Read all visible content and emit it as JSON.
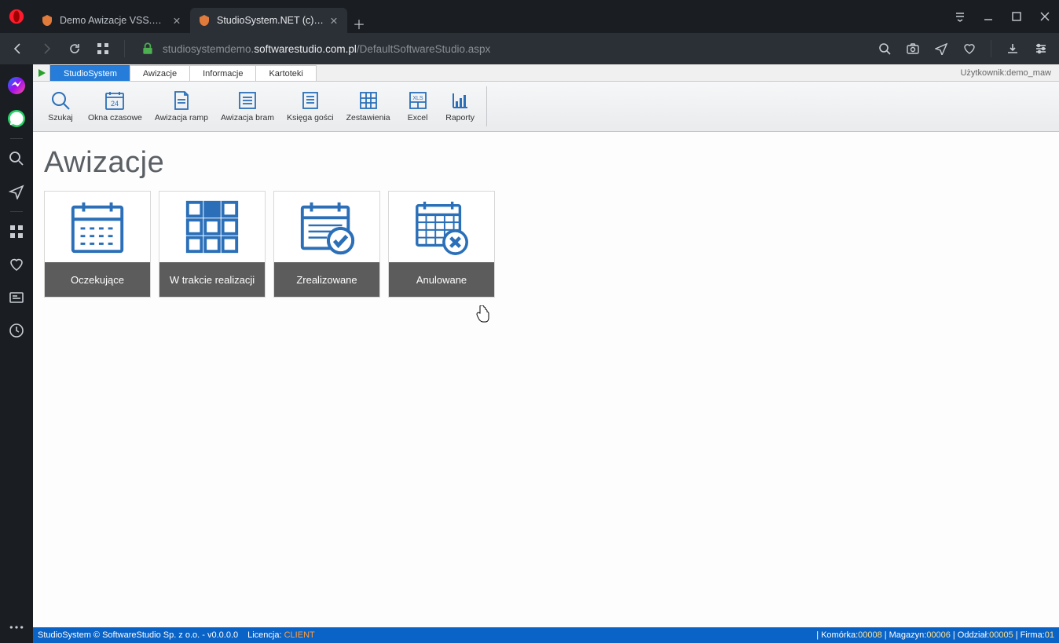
{
  "browser": {
    "tabs": [
      {
        "title": "Demo Awizacje VSS.net - D",
        "active": false
      },
      {
        "title": "StudioSystem.NET (c) Softw",
        "active": true
      }
    ],
    "url_pre": "studiosystemdemo.",
    "url_bold": "softwarestudio.com.pl",
    "url_post": "/DefaultSoftwareStudio.aspx"
  },
  "app": {
    "tabs": {
      "primary": "StudioSystem",
      "t1": "Awizacje",
      "t2": "Informacje",
      "t3": "Kartoteki"
    },
    "user_prefix": "Użytkownik: ",
    "user": "demo_maw",
    "ribbon": {
      "r0": "Szukaj",
      "r1": "Okna czasowe",
      "r2": "Awizacja ramp",
      "r3": "Awizacja bram",
      "r4": "Księga gości",
      "r5": "Zestawienia",
      "r6": "Excel",
      "r7": "Raporty"
    },
    "page_title": "Awizacje",
    "cards": {
      "c0": "Oczekujące",
      "c1": "W trakcie realizacji",
      "c2": "Zrealizowane",
      "c3": "Anulowane"
    },
    "footer": {
      "copyright": "StudioSystem © SoftwareStudio Sp. z o.o. - v0.0.0.0",
      "lic_label": "Licencja: ",
      "lic_value": "CLIENT",
      "cell_label": "Komórka: ",
      "cell_value": "00008",
      "mag_label": "Magazyn: ",
      "mag_value": "00006",
      "odd_label": "Oddział: ",
      "odd_value": "00005",
      "firm_label": "Firma: ",
      "firm_value": "01"
    }
  }
}
